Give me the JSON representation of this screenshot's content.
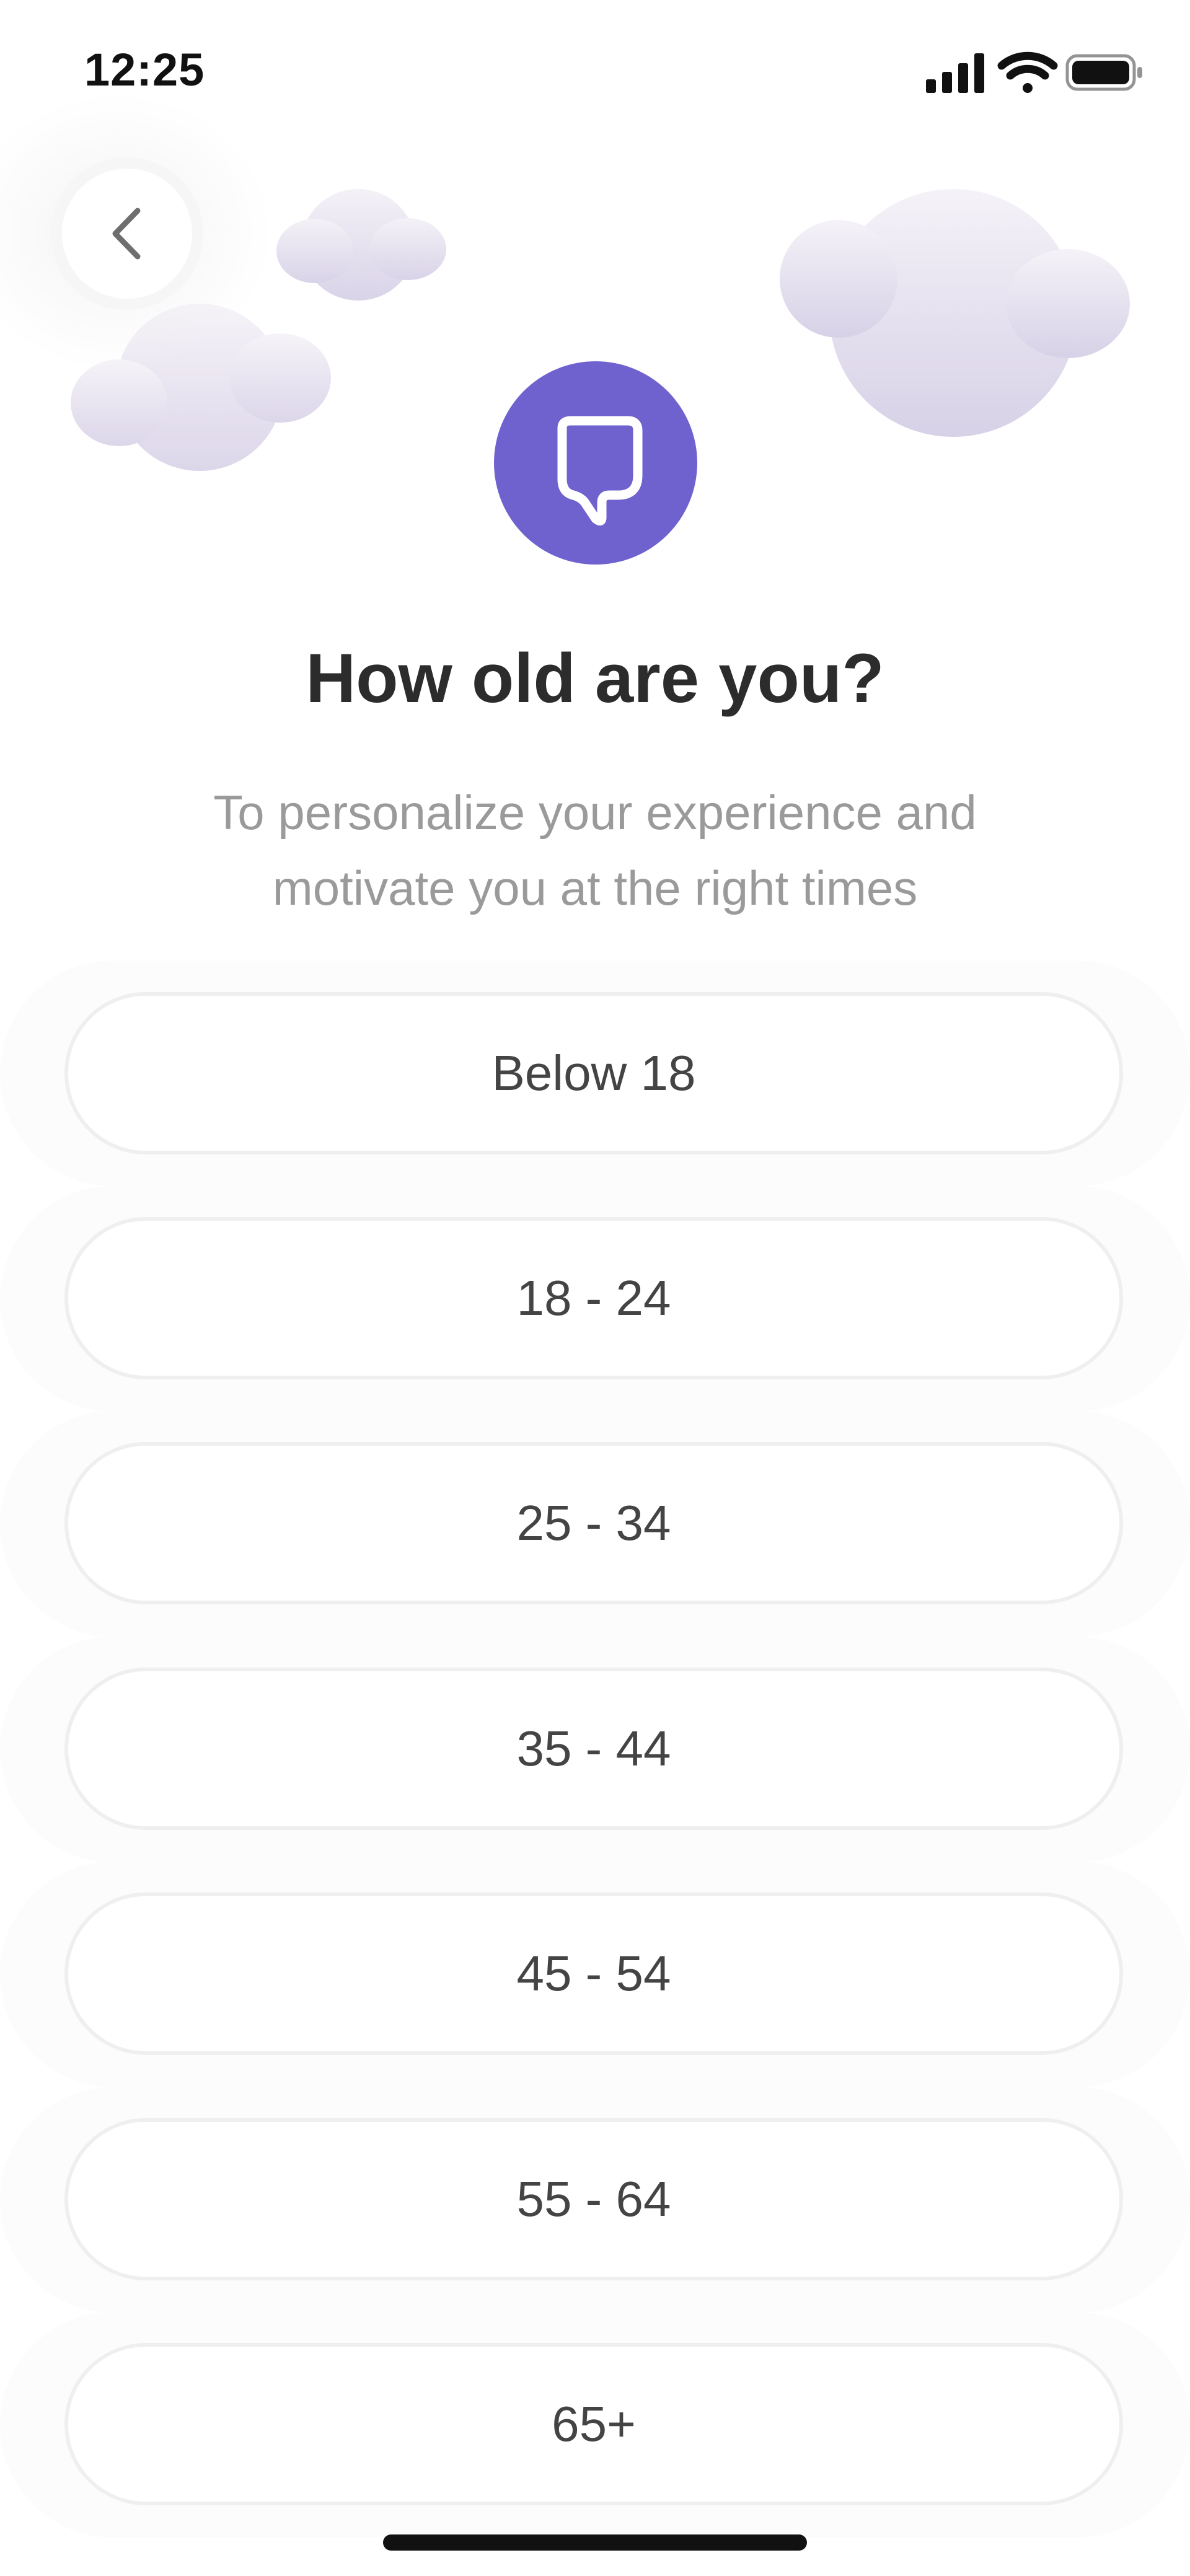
{
  "status_bar": {
    "time": "12:25",
    "icons": [
      "cellular-signal-icon",
      "wifi-icon",
      "battery-icon"
    ]
  },
  "header": {
    "back_icon": "chevron-left-icon",
    "app_icon": "chat-bubble-icon",
    "decorations": [
      "cloud",
      "cloud",
      "cloud"
    ]
  },
  "question": {
    "title": "How old are you?",
    "subtitle_line1": "To personalize your experience and",
    "subtitle_line2": "motivate you at the right times"
  },
  "age_options": [
    {
      "label": "Below 18"
    },
    {
      "label": "18 - 24"
    },
    {
      "label": "25 - 34"
    },
    {
      "label": "35 - 44"
    },
    {
      "label": "45 - 54"
    },
    {
      "label": "55 - 64"
    },
    {
      "label": "65+"
    }
  ],
  "colors": {
    "accent": "#6f62cf",
    "title": "#2c2c2c",
    "subtitle": "#9a9a9a",
    "option_text": "#444444",
    "option_border": "#efefef",
    "cloud": "#e6e1ef"
  }
}
